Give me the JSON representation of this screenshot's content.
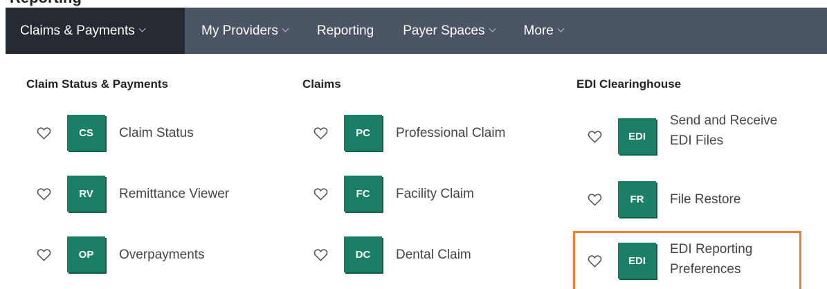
{
  "page": {
    "title": "Reporting"
  },
  "nav": {
    "items": [
      {
        "label": "Claims & Payments",
        "has_menu": true,
        "active": true
      },
      {
        "label": "My Providers",
        "has_menu": true,
        "active": false
      },
      {
        "label": "Reporting",
        "has_menu": false,
        "active": false
      },
      {
        "label": "Payer Spaces",
        "has_menu": true,
        "active": false
      },
      {
        "label": "More",
        "has_menu": true,
        "active": false
      }
    ]
  },
  "menu": {
    "columns": [
      {
        "heading": "Claim Status & Payments",
        "items": [
          {
            "badge": "CS",
            "label": "Claim Status"
          },
          {
            "badge": "RV",
            "label": "Remittance Viewer"
          },
          {
            "badge": "OP",
            "label": "Overpayments"
          }
        ]
      },
      {
        "heading": "Claims",
        "items": [
          {
            "badge": "PC",
            "label": "Professional Claim"
          },
          {
            "badge": "FC",
            "label": "Facility Claim"
          },
          {
            "badge": "DC",
            "label": "Dental Claim"
          }
        ]
      },
      {
        "heading": "EDI Clearinghouse",
        "items": [
          {
            "badge": "EDI",
            "label_line1": "Send and Receive",
            "label_line2": "EDI Files"
          },
          {
            "badge": "FR",
            "label": "File Restore"
          },
          {
            "badge": "EDI",
            "label_line1": "EDI Reporting",
            "label_line2": "Preferences",
            "highlighted": true
          }
        ]
      }
    ]
  },
  "colors": {
    "nav_bg": "#4c5563",
    "nav_active_bg": "#262b33",
    "tile_bg": "#1a7f64",
    "highlight": "#f47c33"
  },
  "icons": {
    "favorite": "heart-outline-icon",
    "dropdown": "chevron-down-icon"
  }
}
